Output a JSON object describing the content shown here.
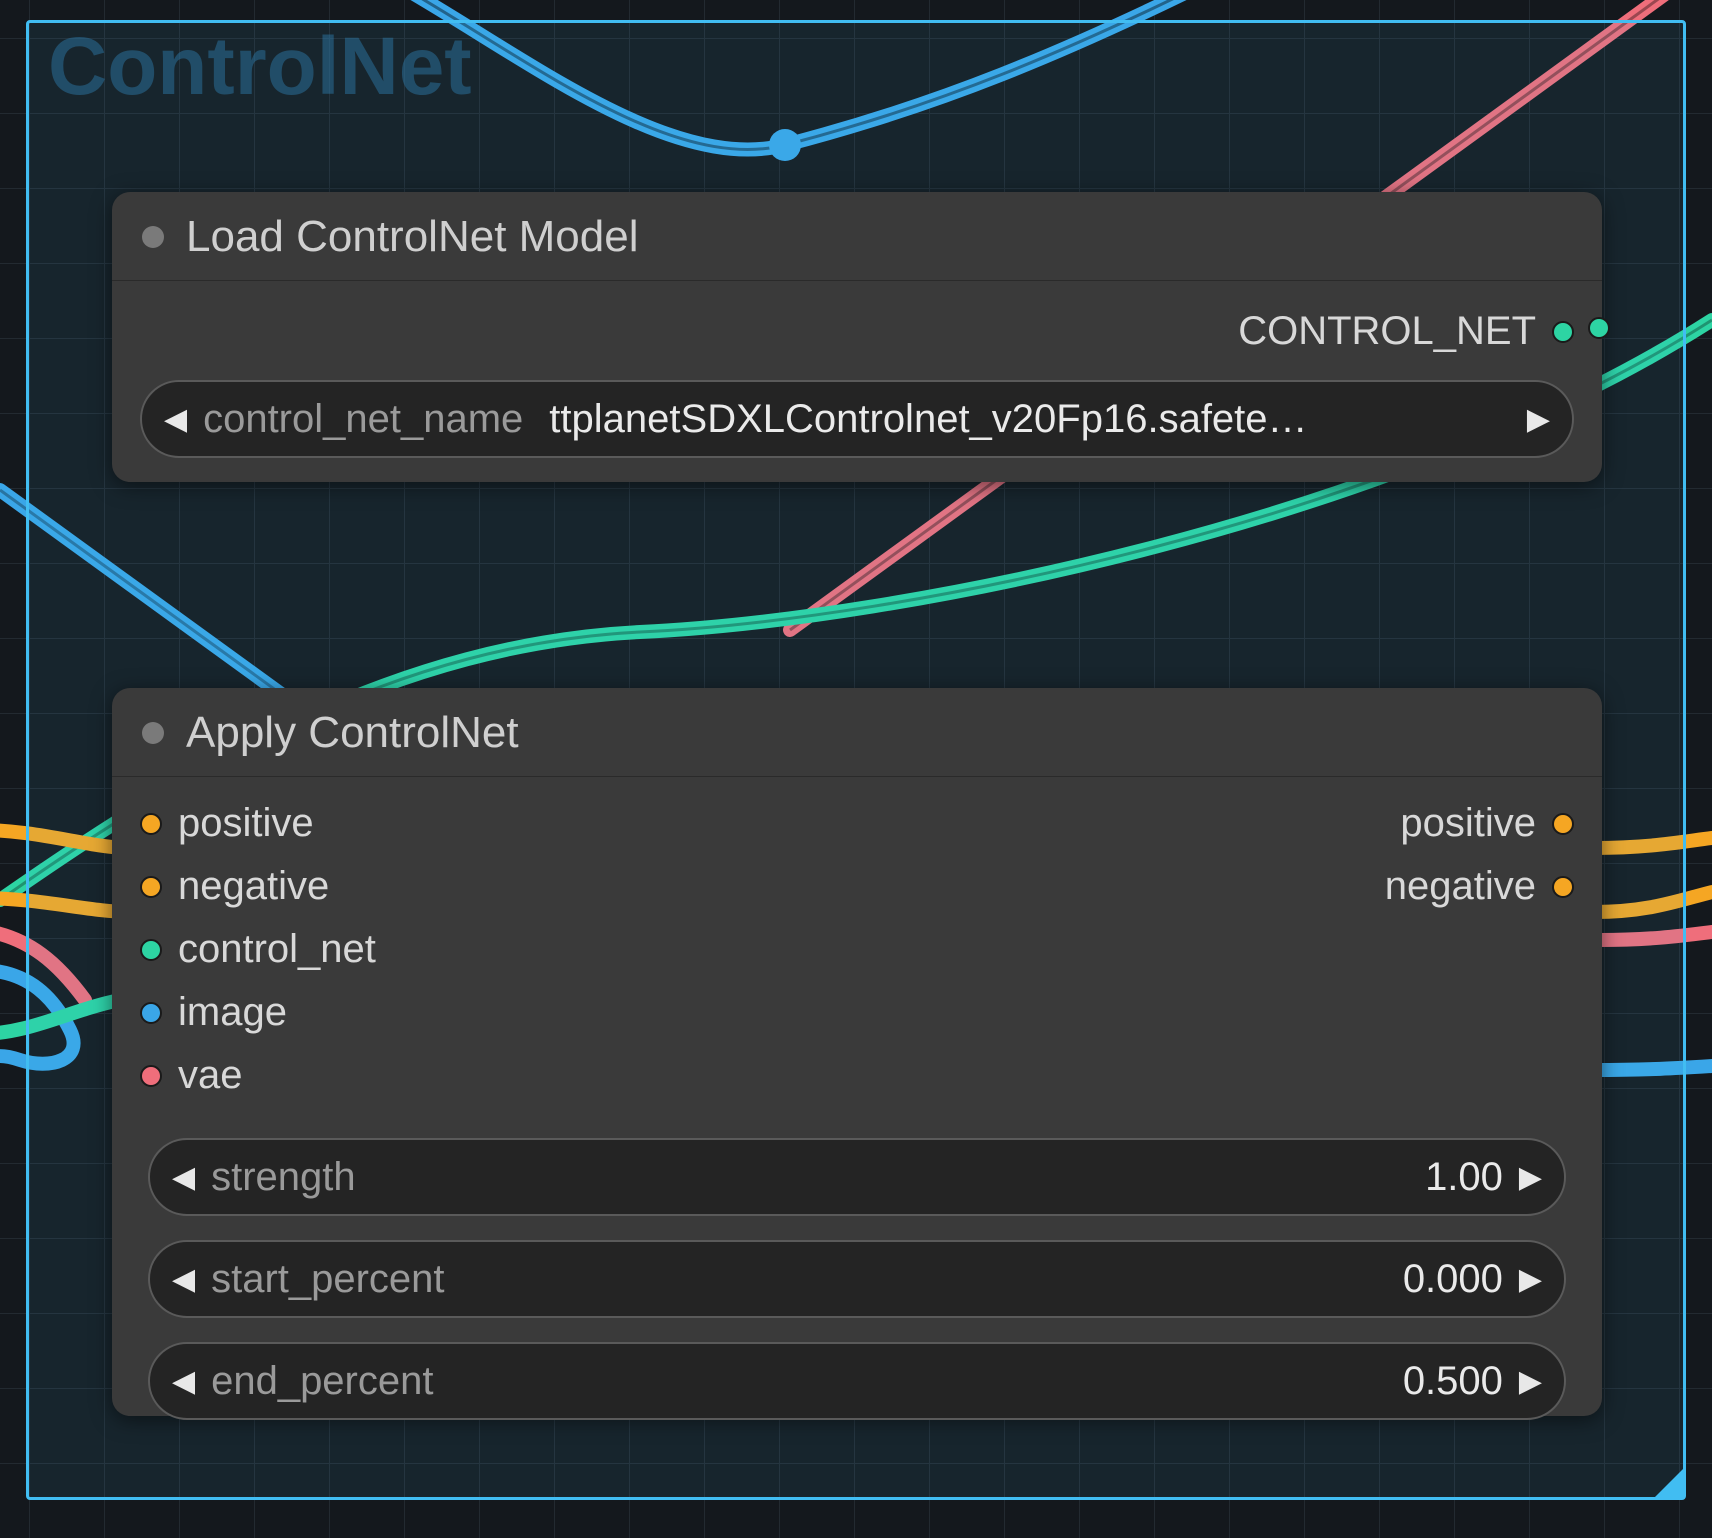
{
  "group": {
    "title": "ControlNet"
  },
  "colors": {
    "controlnet": "#2dd4a3",
    "conditioning": "#f5a623",
    "image": "#3aa6e8",
    "vae": "#ef6e7b"
  },
  "nodes": {
    "load": {
      "title": "Load ControlNet Model",
      "outputs": [
        {
          "name": "CONTROL_NET",
          "type": "controlnet"
        }
      ],
      "params": {
        "control_net_name": {
          "label": "control_net_name",
          "value": "ttplanetSDXLControlnet_v20Fp16.safete…"
        }
      }
    },
    "apply": {
      "title": "Apply ControlNet",
      "inputs": [
        {
          "name": "positive",
          "type": "conditioning"
        },
        {
          "name": "negative",
          "type": "conditioning"
        },
        {
          "name": "control_net",
          "type": "controlnet"
        },
        {
          "name": "image",
          "type": "image"
        },
        {
          "name": "vae",
          "type": "vae"
        }
      ],
      "outputs": [
        {
          "name": "positive",
          "type": "conditioning"
        },
        {
          "name": "negative",
          "type": "conditioning"
        }
      ],
      "params": {
        "strength": {
          "label": "strength",
          "value": "1.00"
        },
        "start_percent": {
          "label": "start_percent",
          "value": "0.000"
        },
        "end_percent": {
          "label": "end_percent",
          "value": "0.500"
        }
      }
    }
  }
}
